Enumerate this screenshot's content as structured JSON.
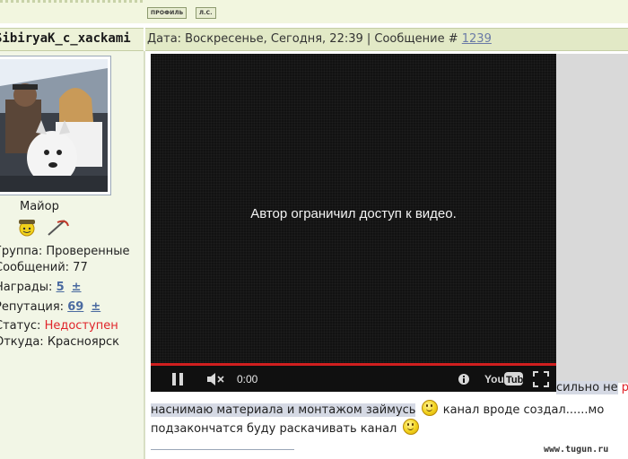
{
  "top": {
    "profile_btn": "ПРОФИЛЬ",
    "pm_btn": "Л.С."
  },
  "post": {
    "username": "SibiryaK_c_xackami",
    "date_prefix": "Дата: Воскресенье, Сегодня, 22:39 | Сообщение #",
    "message_number": "1239"
  },
  "user": {
    "rank": "Майор",
    "group_label": "Группа:",
    "group_value": "Проверенные",
    "messages_label": "Сообщений:",
    "messages_value": "77",
    "awards_label": "Награды:",
    "awards_value": "5",
    "reputation_label": "Репутация:",
    "reputation_value": "69",
    "plus": "±",
    "status_label": "Статус:",
    "status_value": "Недоступен",
    "from_label": "Откуда:",
    "from_value": "Красноярск"
  },
  "video": {
    "message": "Автор ограничил доступ к видео.",
    "time": "0:00",
    "youtube_label": "YouTube"
  },
  "message": {
    "line1_tail": "сильно не",
    "line2_highlight": "наснимаю материала и монтажом займусь",
    "line2_rest": "канал вроде создал......мо",
    "line3": "подзакончатся буду раскачивать канал"
  },
  "watermark": "www.tugun.ru",
  "colors": {
    "header_bg": "#e2e9c6",
    "sidebar_bg": "#f2f6e6",
    "link": "#6a7aa6",
    "offline": "#e0242a",
    "progress": "#d01f1f"
  }
}
